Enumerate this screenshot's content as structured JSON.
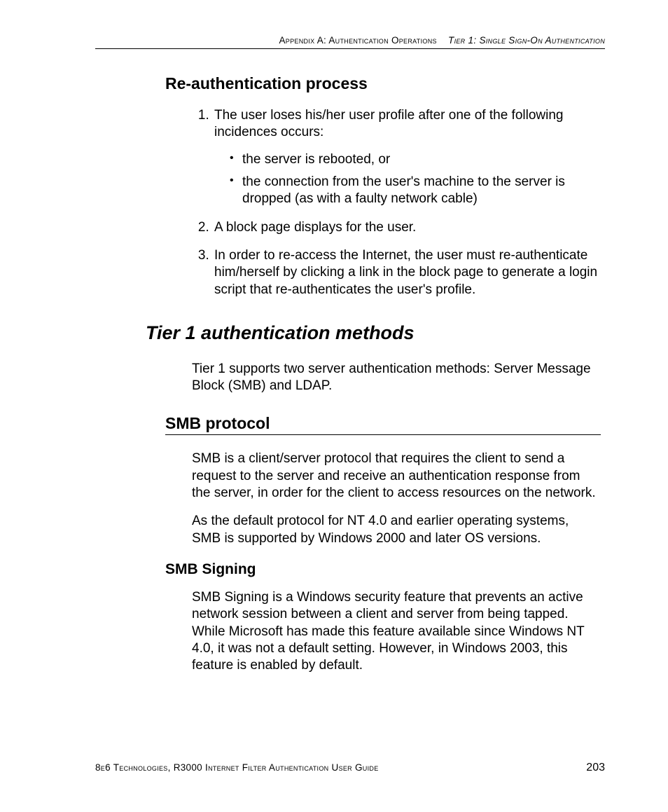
{
  "header": {
    "part1": "Appendix A: Authentication Operations",
    "part2": "Tier 1: Single Sign-On Authentication"
  },
  "sections": {
    "reauth": {
      "title": "Re-authentication process",
      "item1_text": "The user loses his/her user profile after one of the following incidences occurs:",
      "bullet1": "the server is rebooted, or",
      "bullet2": "the connection from the user's machine to the server is dropped (as with a faulty network cable)",
      "item2_text": "A block page displays for the user.",
      "item3_text": "In order to re-access the Internet, the user must re-authenticate him/herself by clicking a link in the block page to generate a login script that re-authenticates the user's profile."
    },
    "tier1": {
      "title": "Tier 1 authentication methods",
      "intro": "Tier 1 supports two server authentication methods: Server Message Block (SMB) and LDAP."
    },
    "smb": {
      "title": "SMB protocol",
      "p1": "SMB is a client/server protocol that requires the client to send a request to the server and receive an authentication response from the server, in order for the client to access resources on the network.",
      "p2": "As the default protocol for NT 4.0 and earlier operating systems, SMB is supported by Windows 2000 and later OS versions."
    },
    "smb_signing": {
      "title": "SMB Signing",
      "p1": "SMB Signing is a Windows security feature that prevents an active network session between a client and server from being tapped. While Microsoft has made this feature available since Windows NT 4.0, it was not a default setting. However, in Windows 2003, this feature is enabled by default."
    }
  },
  "footer": {
    "left": "8e6 Technologies, R3000 Internet Filter Authentication User Guide",
    "page": "203"
  }
}
